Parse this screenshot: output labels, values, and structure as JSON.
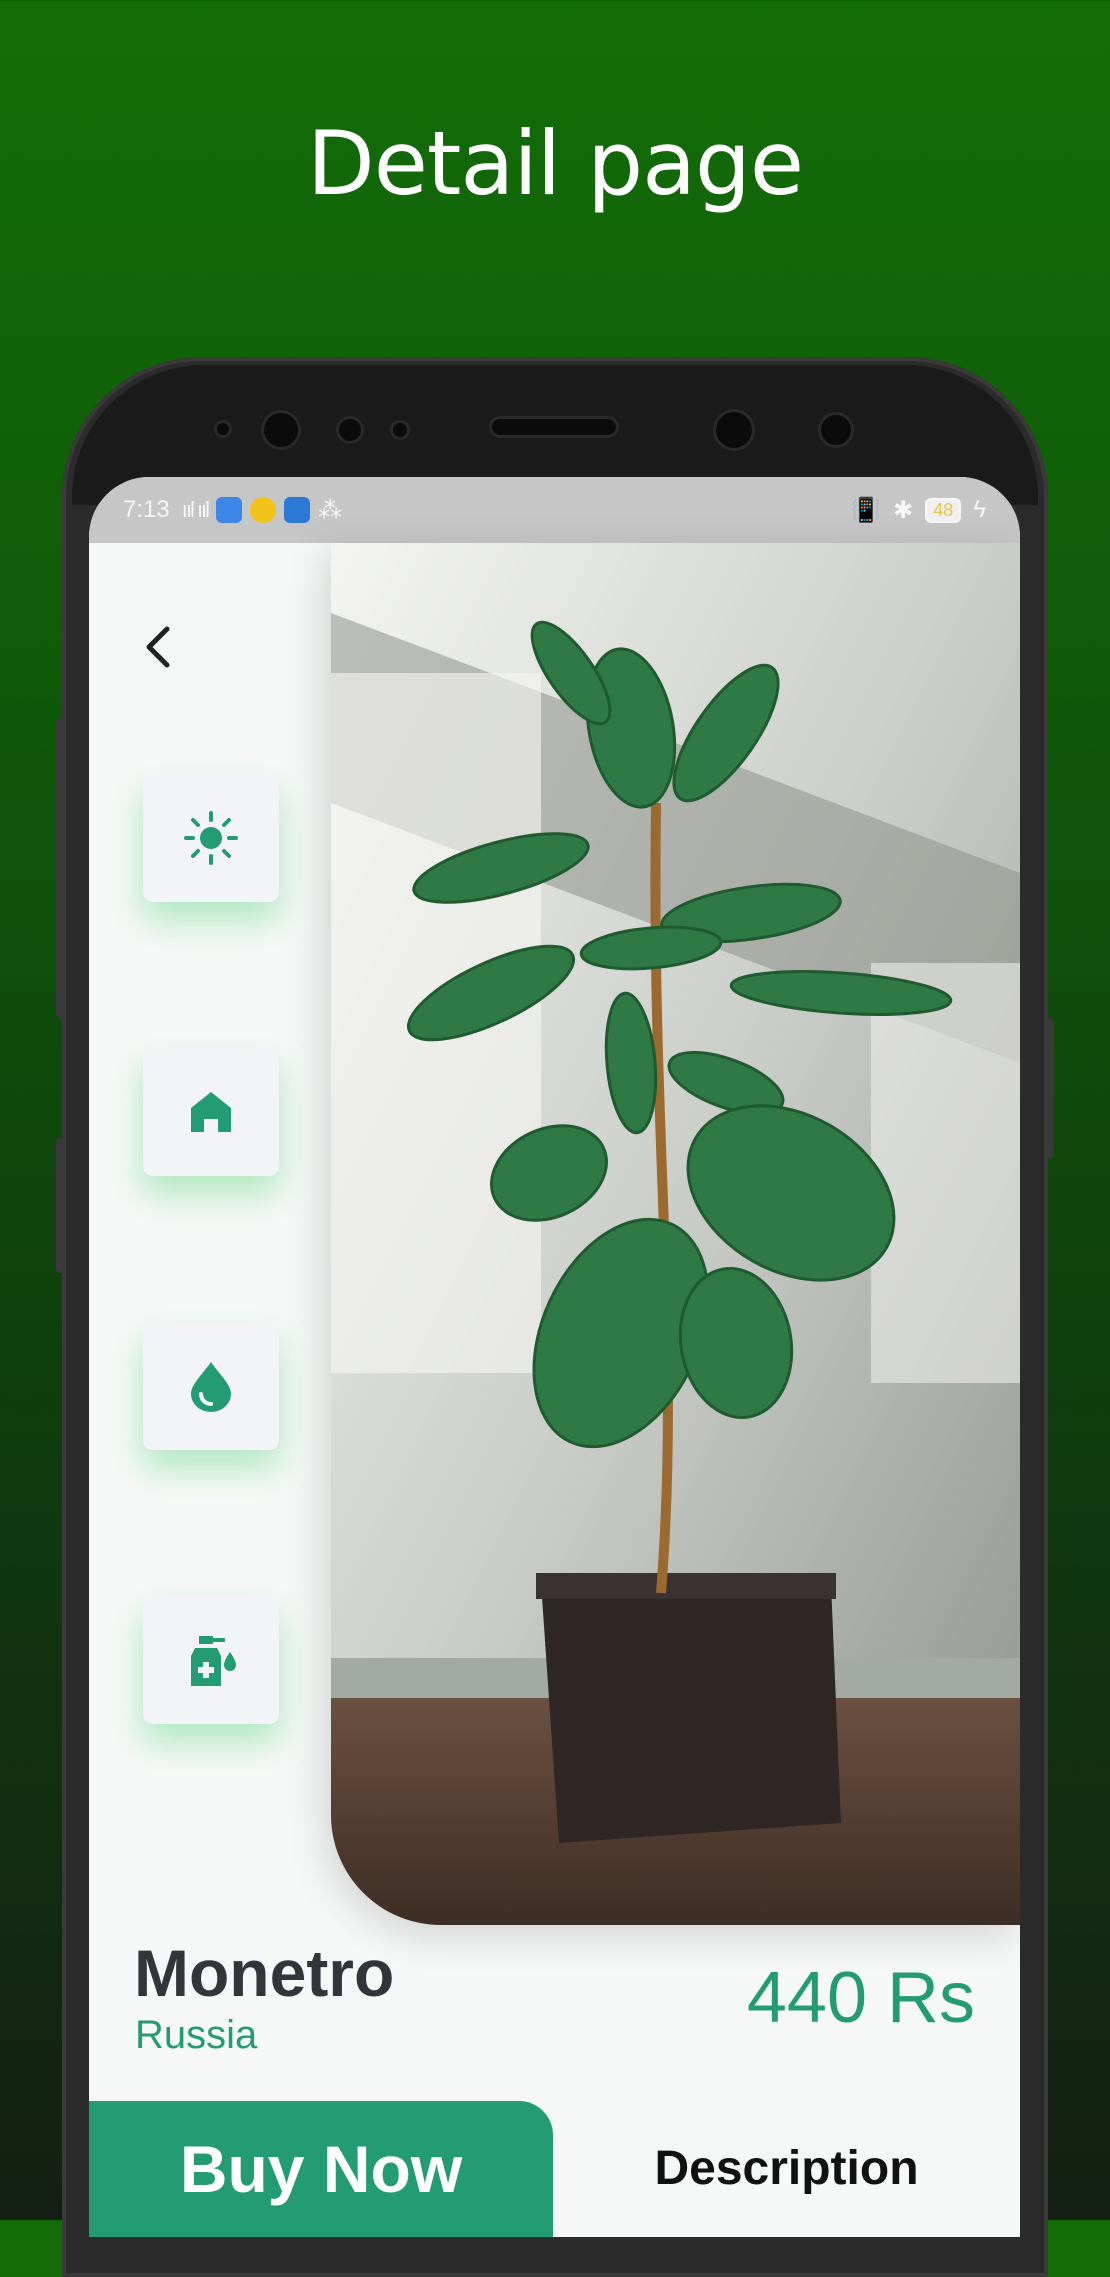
{
  "headline": "Detail page",
  "status_bar": {
    "time": "7:13",
    "signal": "ııl ııl",
    "battery": "48"
  },
  "product": {
    "name": "Monetro",
    "origin": "Russia",
    "price": "440 Rs"
  },
  "actions": {
    "buy": "Buy Now",
    "description": "Description"
  },
  "features": [
    {
      "icon": "sun-icon"
    },
    {
      "icon": "home-icon"
    },
    {
      "icon": "water-drop-icon"
    },
    {
      "icon": "fertilizer-spray-icon"
    }
  ],
  "colors": {
    "accent": "#249c73",
    "background_top": "#136d07",
    "background_bottom": "#141f13",
    "text_dark": "#33353b"
  }
}
